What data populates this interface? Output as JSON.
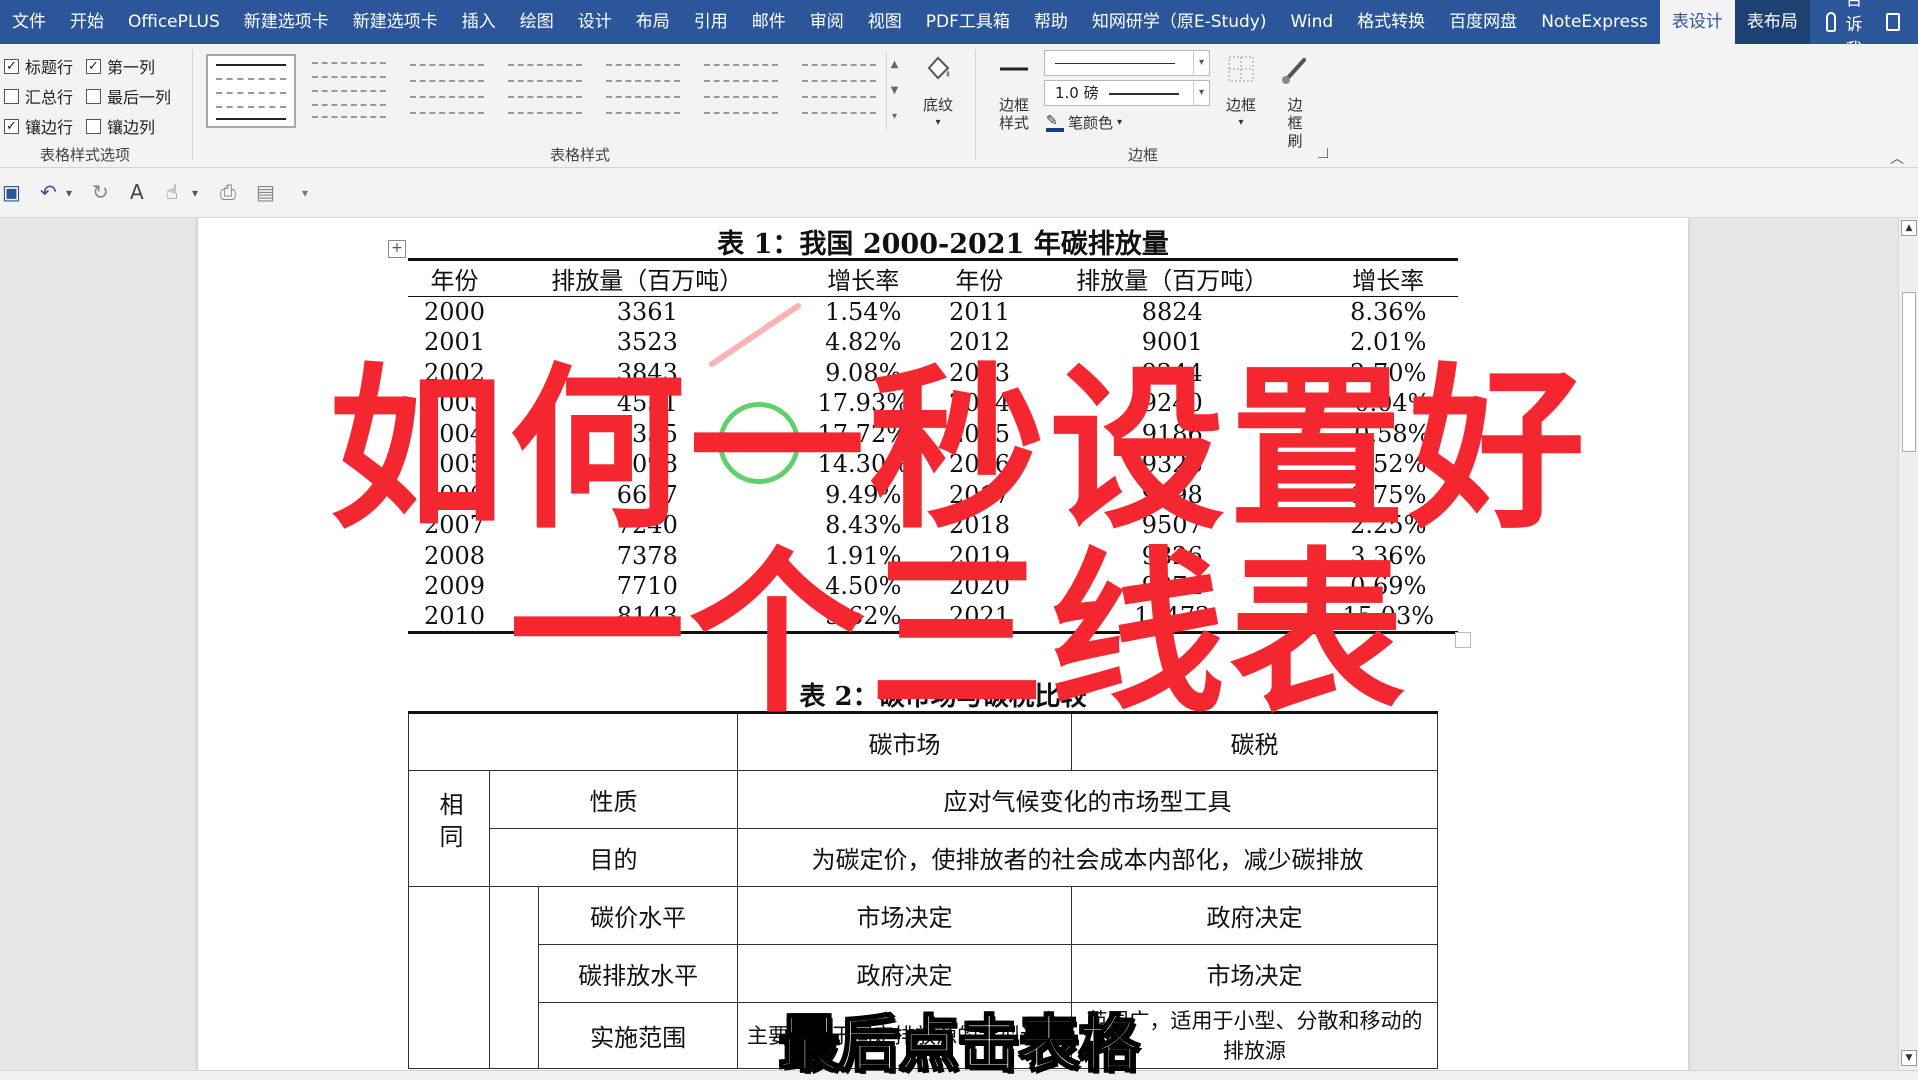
{
  "ribbon_tabs": [
    "文件",
    "开始",
    "OfficePLUS",
    "新建选项卡",
    "新建选项卡",
    "插入",
    "绘图",
    "设计",
    "布局",
    "引用",
    "邮件",
    "审阅",
    "视图",
    "PDF工具箱",
    "帮助",
    "知网研学（原E-Study)",
    "Wind",
    "格式转换",
    "百度网盘",
    "NoteExpress",
    "表设计",
    "表布局"
  ],
  "tell_me": "告诉我",
  "table_style_options": {
    "header_row": {
      "label": "标题行",
      "checked": true
    },
    "first_column": {
      "label": "第一列",
      "checked": true
    },
    "total_row": {
      "label": "汇总行",
      "checked": false
    },
    "last_column": {
      "label": "最后一列",
      "checked": false
    },
    "banded_rows": {
      "label": "镶边行",
      "checked": true
    },
    "banded_columns": {
      "label": "镶边列",
      "checked": false
    },
    "group_label": "表格样式选项"
  },
  "table_styles": {
    "group_label": "表格样式",
    "shading_label": "底纹"
  },
  "borders": {
    "border_styles_label": "边框样式",
    "weight": "1.0 磅",
    "pen_color_label": "笔颜色",
    "borders_label": "边框",
    "border_painter_label": "边框刷",
    "group_label": "边框"
  },
  "table1": {
    "title": "表 1：我国 2000-2021 年碳排放量",
    "headers": [
      "年份",
      "排放量（百万吨）",
      "增长率",
      "年份",
      "排放量（百万吨）",
      "增长率"
    ],
    "rows": [
      [
        "2000",
        "3361",
        "1.54%",
        "2011",
        "8824",
        "8.36%"
      ],
      [
        "2001",
        "3523",
        "4.82%",
        "2012",
        "9001",
        "2.01%"
      ],
      [
        "2002",
        "3843",
        "9.08%",
        "2013",
        "9244",
        "2.70%"
      ],
      [
        "2003",
        "4531",
        "17.93%",
        "2014",
        "9240",
        "-0.04%"
      ],
      [
        "2004",
        "5335",
        "17.72%",
        "2015",
        "9186",
        "-0.58%"
      ],
      [
        "2005",
        "6098",
        "14.30%",
        "2016",
        "9328",
        "1.52%"
      ],
      [
        "2006",
        "6677",
        "9.49%",
        "2017",
        "9498",
        "1.75%"
      ],
      [
        "2007",
        "7240",
        "8.43%",
        "2018",
        "9507",
        "2.25%"
      ],
      [
        "2008",
        "7378",
        "1.91%",
        "2019",
        "9826",
        "3.36%"
      ],
      [
        "2009",
        "7710",
        "4.50%",
        "2020",
        "9974",
        "0.69%"
      ],
      [
        "2010",
        "8143",
        "5.62%",
        "2021",
        "11472",
        "15.03%"
      ]
    ]
  },
  "table2": {
    "title": "表 2：碳市场与碳税比较",
    "col_market": "碳市场",
    "col_tax": "碳税",
    "same_label": "相同",
    "row_nature": {
      "label": "性质",
      "value": "应对气候变化的市场型工具"
    },
    "row_purpose": {
      "label": "目的",
      "value": "为碳定价，使排放者的社会成本内部化，减少碳排放"
    },
    "row_price": {
      "label": "碳价水平",
      "market": "市场决定",
      "tax": "政府决定"
    },
    "row_emission": {
      "label": "碳排放水平",
      "market": "政府决定",
      "tax": "市场决定"
    },
    "row_scope": {
      "label": "实施范围",
      "market": "主要适用于固定排放源的大型设施",
      "tax": "范围广，适用于小型、分散和移动的排放源"
    }
  },
  "overlay": {
    "line1": "如何一秒设置好",
    "line2": "一个三线表",
    "subtitle": "最后点击表格"
  },
  "colors": {
    "ribbon_blue": "#2b579a",
    "overlay_red": "#f4262f"
  }
}
